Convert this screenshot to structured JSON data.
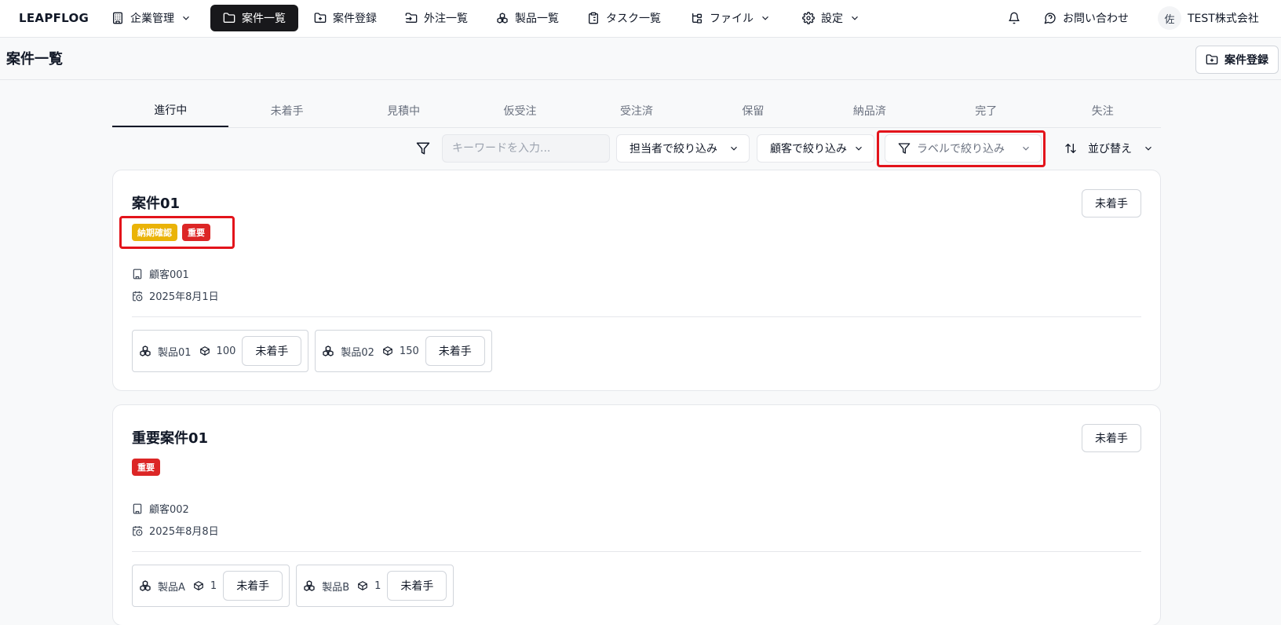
{
  "app": {
    "brand": "LEAPFLOG",
    "nav": [
      {
        "label": "企業管理",
        "icon": "building-icon",
        "dropdown": true
      },
      {
        "label": "案件一覧",
        "icon": "folder-icon",
        "active": true
      },
      {
        "label": "案件登録",
        "icon": "folder-plus-icon"
      },
      {
        "label": "外注一覧",
        "icon": "folder-output-icon"
      },
      {
        "label": "製品一覧",
        "icon": "boxes-icon"
      },
      {
        "label": "タスク一覧",
        "icon": "clipboard-list-icon"
      },
      {
        "label": "ファイル",
        "icon": "file-tree-icon",
        "dropdown": true
      },
      {
        "label": "設定",
        "icon": "gear-icon",
        "dropdown": true
      }
    ],
    "contact": "お問い合わせ",
    "user_initial": "佐",
    "company": "TEST株式会社"
  },
  "page": {
    "title": "案件一覧",
    "register_button": "案件登録"
  },
  "tabs": [
    "進行中",
    "未着手",
    "見積中",
    "仮受注",
    "受注済",
    "保留",
    "納品済",
    "完了",
    "失注"
  ],
  "filters": {
    "keyword_placeholder": "キーワードを入力...",
    "assignee": "担当者で絞り込み",
    "customer": "顧客で絞り込み",
    "label": "ラベルで絞り込み",
    "sort": "並び替え"
  },
  "colors": {
    "badge_yellow": "#eab308",
    "badge_red": "#dc2626",
    "highlight": "#e3141b",
    "nav_active": "#18181b"
  },
  "projects": [
    {
      "title": "案件01",
      "status": "未着手",
      "labels": [
        {
          "text": "納期確認",
          "color": "#eab308"
        },
        {
          "text": "重要",
          "color": "#dc2626"
        }
      ],
      "customer": "顧客001",
      "date": "2025年8月1日",
      "products": [
        {
          "name": "製品01",
          "qty": "100",
          "status": "未着手"
        },
        {
          "name": "製品02",
          "qty": "150",
          "status": "未着手"
        }
      ]
    },
    {
      "title": "重要案件01",
      "status": "未着手",
      "labels": [
        {
          "text": "重要",
          "color": "#dc2626"
        }
      ],
      "customer": "顧客002",
      "date": "2025年8月8日",
      "products": [
        {
          "name": "製品A",
          "qty": "1",
          "status": "未着手"
        },
        {
          "name": "製品B",
          "qty": "1",
          "status": "未着手"
        }
      ]
    }
  ]
}
